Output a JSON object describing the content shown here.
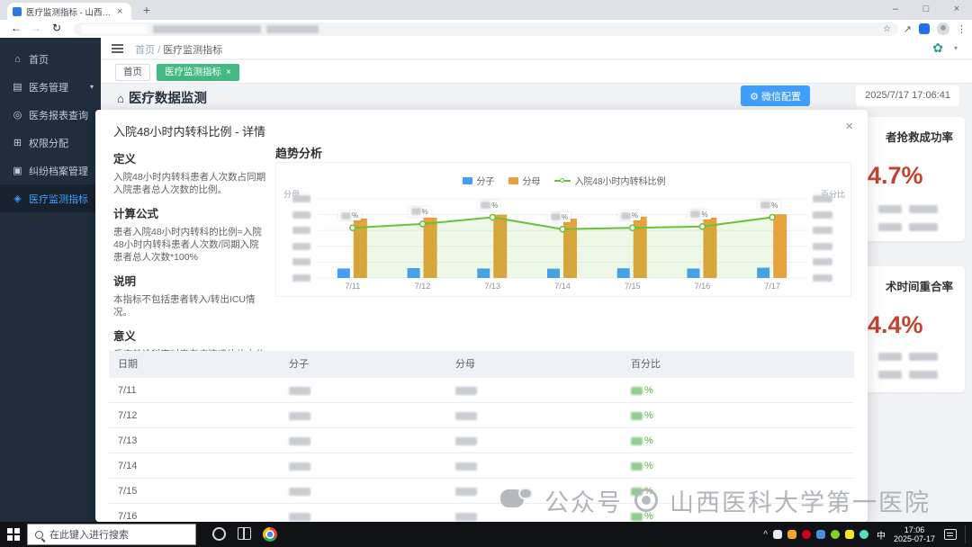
{
  "colors": {
    "accent_blue": "#409EFF",
    "tag_green": "#42b983",
    "sidebar_bg": "#1f2d3d",
    "bar_blue": "#409EFF",
    "bar_orange": "#E6A23C",
    "line_green": "#67C23A",
    "card_value_red": "#c14433"
  },
  "browser": {
    "tab_title": "医疗监测指标 - 山西医科大学第...",
    "tab_close": "×",
    "new_tab_button": "+",
    "window_minimize": "–",
    "window_maximize": "□",
    "window_close": "×",
    "nav_back": "←",
    "nav_forward": "→",
    "nav_reload": "↻",
    "bookmark_star": "☆",
    "share_arrow": "↗",
    "menu_dots": "⋮"
  },
  "sidebar": {
    "items": [
      {
        "label": "首页",
        "glyph": "⌂"
      },
      {
        "label": "医务管理",
        "glyph": "▤",
        "arrow": "▾"
      },
      {
        "label": "医务报表查询",
        "glyph": "◎"
      },
      {
        "label": "权限分配",
        "glyph": "⊞"
      },
      {
        "label": "纠纷档案管理",
        "glyph": "▣"
      },
      {
        "label": "医疗监测指标",
        "glyph": "◈"
      }
    ]
  },
  "appbar": {
    "breadcrumb_home": "首页",
    "breadcrumb_separator": "/",
    "breadcrumb_current": "医疗监测指标",
    "logo_glyph": "✿",
    "caret": "▾"
  },
  "tagbar": {
    "tag_home": "首页",
    "tag_active": "医疗监测指标",
    "tag_close": "×"
  },
  "pageheader": {
    "home_glyph": "⌂",
    "title": "医疗数据监测",
    "config_gear": "⚙",
    "config_button": "微信配置",
    "timestamp": "2025/7/17 17:06:41"
  },
  "modal": {
    "title": "入院48小时内转科比例 - 详情",
    "close": "×",
    "sections": {
      "definition_heading": "定义",
      "definition_body": "入院48小时内转科患者人次数占同期入院患者总人次数的比例。",
      "formula_heading": "计算公式",
      "formula_body": "患者入院48小时内转科的比例=入院48小时内转科患者人次数/同期入院患者总人次数*100%",
      "note_heading": "说明",
      "note_body": "本指标不包括患者转入/转出ICU情况。",
      "meaning_heading": "意义",
      "meaning_body": "反应首诊科室对患者病情评估的充分性。"
    },
    "trend_heading": "趋势分析",
    "table": {
      "headers": [
        "日期",
        "分子",
        "分母",
        "百分比"
      ],
      "rows": [
        {
          "date": "7/11"
        },
        {
          "date": "7/12"
        },
        {
          "date": "7/13"
        },
        {
          "date": "7/14"
        },
        {
          "date": "7/15"
        },
        {
          "date": "7/16"
        }
      ],
      "percent_suffix": "%"
    }
  },
  "chart_data": {
    "type": "bar+line",
    "categories": [
      "7/11",
      "7/12",
      "7/13",
      "7/14",
      "7/15",
      "7/16",
      "7/17"
    ],
    "series": [
      {
        "name": "分子",
        "type": "bar",
        "color": "#409EFF",
        "values": [
          48,
          50,
          48,
          47,
          49,
          48,
          52
        ]
      },
      {
        "name": "分母",
        "type": "bar",
        "color": "#E6A23C",
        "values": [
          300,
          305,
          320,
          300,
          310,
          305,
          322
        ]
      },
      {
        "name": "入院48小时内转科比例",
        "type": "line",
        "color": "#67C23A",
        "unit": "%",
        "values": [
          3.8,
          4.1,
          4.6,
          3.7,
          3.8,
          3.9,
          4.6
        ]
      }
    ],
    "left_axis_label": "分母",
    "right_axis_label": "百分比",
    "left_axis_max": 400,
    "right_axis_max": 6,
    "grid": true,
    "legend_position": "top-center",
    "tick_labels_redacted": true
  },
  "right_panel": {
    "card1_title_fragment": "者抢救成功率",
    "card1_value_fragment": "4.7%",
    "card2_title_fragment": "术时间重合率",
    "card2_value_fragment": "4.4%"
  },
  "watermark": {
    "account_label": "公众号",
    "hospital_name": "山西医科大学第一医院"
  },
  "taskbar": {
    "search_placeholder": "在此键入进行搜索",
    "tray_caret": "^",
    "ime_indicator": "中",
    "time": "17:06",
    "date": "2025-07-17"
  }
}
